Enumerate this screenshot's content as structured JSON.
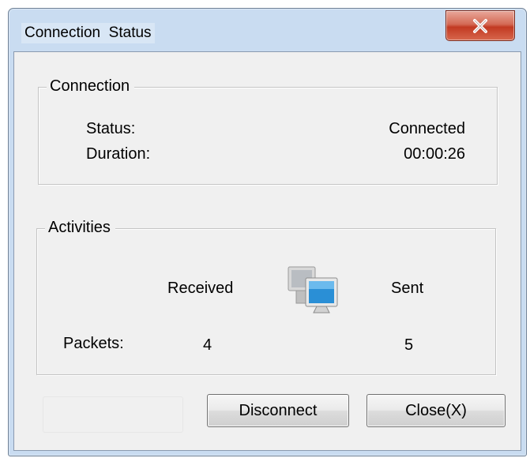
{
  "window": {
    "title": "Connection  Status",
    "close_glyph": "X"
  },
  "connection_group": {
    "legend": "Connection",
    "status_label": "Status:",
    "status_value": "Connected",
    "duration_label": "Duration:",
    "duration_value": "00:00:26"
  },
  "activities_group": {
    "legend": "Activities",
    "received_header": "Received",
    "sent_header": "Sent",
    "packets_label": "Packets:",
    "packets_received": "4",
    "packets_sent": "5",
    "icon": "network-computers-icon"
  },
  "buttons": {
    "disconnect": "Disconnect",
    "close": "Close(X)"
  },
  "colors": {
    "frame": "#c9dcf1",
    "client": "#f0f0f0",
    "close_button": "#c8432b"
  }
}
